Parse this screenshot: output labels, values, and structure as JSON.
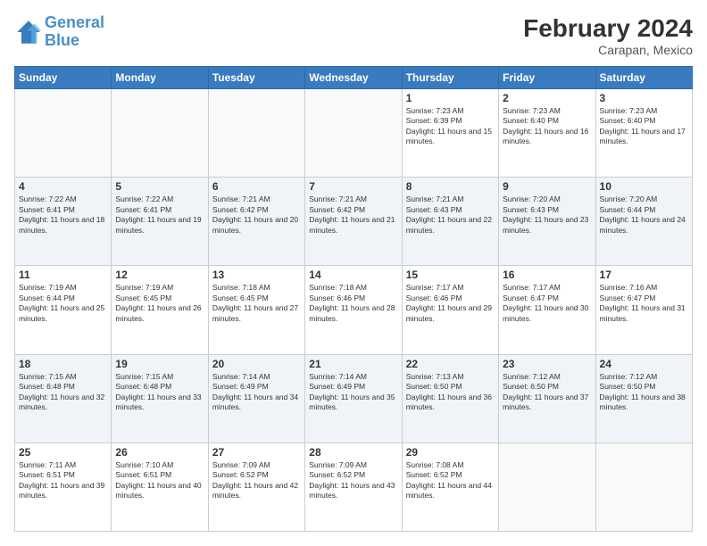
{
  "header": {
    "logo_line1": "General",
    "logo_line2": "Blue",
    "title": "February 2024",
    "subtitle": "Carapan, Mexico"
  },
  "days_of_week": [
    "Sunday",
    "Monday",
    "Tuesday",
    "Wednesday",
    "Thursday",
    "Friday",
    "Saturday"
  ],
  "weeks": [
    [
      {
        "day": "",
        "info": ""
      },
      {
        "day": "",
        "info": ""
      },
      {
        "day": "",
        "info": ""
      },
      {
        "day": "",
        "info": ""
      },
      {
        "day": "1",
        "info": "Sunrise: 7:23 AM\nSunset: 6:39 PM\nDaylight: 11 hours and 15 minutes."
      },
      {
        "day": "2",
        "info": "Sunrise: 7:23 AM\nSunset: 6:40 PM\nDaylight: 11 hours and 16 minutes."
      },
      {
        "day": "3",
        "info": "Sunrise: 7:23 AM\nSunset: 6:40 PM\nDaylight: 11 hours and 17 minutes."
      }
    ],
    [
      {
        "day": "4",
        "info": "Sunrise: 7:22 AM\nSunset: 6:41 PM\nDaylight: 11 hours and 18 minutes."
      },
      {
        "day": "5",
        "info": "Sunrise: 7:22 AM\nSunset: 6:41 PM\nDaylight: 11 hours and 19 minutes."
      },
      {
        "day": "6",
        "info": "Sunrise: 7:21 AM\nSunset: 6:42 PM\nDaylight: 11 hours and 20 minutes."
      },
      {
        "day": "7",
        "info": "Sunrise: 7:21 AM\nSunset: 6:42 PM\nDaylight: 11 hours and 21 minutes."
      },
      {
        "day": "8",
        "info": "Sunrise: 7:21 AM\nSunset: 6:43 PM\nDaylight: 11 hours and 22 minutes."
      },
      {
        "day": "9",
        "info": "Sunrise: 7:20 AM\nSunset: 6:43 PM\nDaylight: 11 hours and 23 minutes."
      },
      {
        "day": "10",
        "info": "Sunrise: 7:20 AM\nSunset: 6:44 PM\nDaylight: 11 hours and 24 minutes."
      }
    ],
    [
      {
        "day": "11",
        "info": "Sunrise: 7:19 AM\nSunset: 6:44 PM\nDaylight: 11 hours and 25 minutes."
      },
      {
        "day": "12",
        "info": "Sunrise: 7:19 AM\nSunset: 6:45 PM\nDaylight: 11 hours and 26 minutes."
      },
      {
        "day": "13",
        "info": "Sunrise: 7:18 AM\nSunset: 6:45 PM\nDaylight: 11 hours and 27 minutes."
      },
      {
        "day": "14",
        "info": "Sunrise: 7:18 AM\nSunset: 6:46 PM\nDaylight: 11 hours and 28 minutes."
      },
      {
        "day": "15",
        "info": "Sunrise: 7:17 AM\nSunset: 6:46 PM\nDaylight: 11 hours and 29 minutes."
      },
      {
        "day": "16",
        "info": "Sunrise: 7:17 AM\nSunset: 6:47 PM\nDaylight: 11 hours and 30 minutes."
      },
      {
        "day": "17",
        "info": "Sunrise: 7:16 AM\nSunset: 6:47 PM\nDaylight: 11 hours and 31 minutes."
      }
    ],
    [
      {
        "day": "18",
        "info": "Sunrise: 7:15 AM\nSunset: 6:48 PM\nDaylight: 11 hours and 32 minutes."
      },
      {
        "day": "19",
        "info": "Sunrise: 7:15 AM\nSunset: 6:48 PM\nDaylight: 11 hours and 33 minutes."
      },
      {
        "day": "20",
        "info": "Sunrise: 7:14 AM\nSunset: 6:49 PM\nDaylight: 11 hours and 34 minutes."
      },
      {
        "day": "21",
        "info": "Sunrise: 7:14 AM\nSunset: 6:49 PM\nDaylight: 11 hours and 35 minutes."
      },
      {
        "day": "22",
        "info": "Sunrise: 7:13 AM\nSunset: 6:50 PM\nDaylight: 11 hours and 36 minutes."
      },
      {
        "day": "23",
        "info": "Sunrise: 7:12 AM\nSunset: 6:50 PM\nDaylight: 11 hours and 37 minutes."
      },
      {
        "day": "24",
        "info": "Sunrise: 7:12 AM\nSunset: 6:50 PM\nDaylight: 11 hours and 38 minutes."
      }
    ],
    [
      {
        "day": "25",
        "info": "Sunrise: 7:11 AM\nSunset: 6:51 PM\nDaylight: 11 hours and 39 minutes."
      },
      {
        "day": "26",
        "info": "Sunrise: 7:10 AM\nSunset: 6:51 PM\nDaylight: 11 hours and 40 minutes."
      },
      {
        "day": "27",
        "info": "Sunrise: 7:09 AM\nSunset: 6:52 PM\nDaylight: 11 hours and 42 minutes."
      },
      {
        "day": "28",
        "info": "Sunrise: 7:09 AM\nSunset: 6:52 PM\nDaylight: 11 hours and 43 minutes."
      },
      {
        "day": "29",
        "info": "Sunrise: 7:08 AM\nSunset: 6:52 PM\nDaylight: 11 hours and 44 minutes."
      },
      {
        "day": "",
        "info": ""
      },
      {
        "day": "",
        "info": ""
      }
    ]
  ]
}
